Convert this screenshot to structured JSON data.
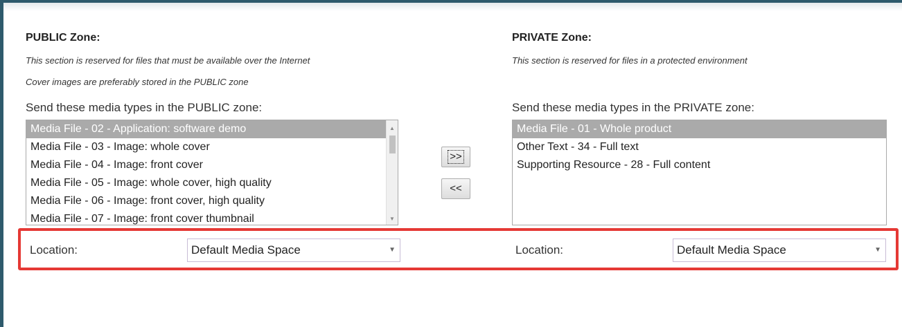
{
  "public": {
    "heading": "PUBLIC Zone:",
    "desc1": "This section is reserved for files that must be available over the Internet",
    "desc2": "Cover images are preferably stored in the PUBLIC zone",
    "send_label": "Send these media types in the PUBLIC zone:",
    "items": [
      "Media File - 02 - Application: software demo",
      "Media File - 03 - Image: whole cover",
      "Media File - 04 - Image: front cover",
      "Media File - 05 - Image: whole cover, high quality",
      "Media File - 06 - Image: front cover, high quality",
      "Media File - 07 - Image: front cover thumbnail"
    ],
    "selected_index": 0,
    "location_label": "Location:",
    "location_value": "Default Media Space"
  },
  "private": {
    "heading": "PRIVATE Zone:",
    "desc1": "This section is reserved for files in a protected environment",
    "send_label": "Send these media types in the PRIVATE zone:",
    "items": [
      "Media File - 01 - Whole product",
      "Other Text - 34 - Full text",
      "Supporting Resource - 28 - Full content"
    ],
    "selected_index": 0,
    "location_label": "Location:",
    "location_value": "Default Media Space"
  },
  "buttons": {
    "move_right": ">>",
    "move_left": "<<"
  },
  "colors": {
    "frame": "#2e5a6c",
    "highlight": "#e53935",
    "selected_row": "#aaaaaa"
  }
}
